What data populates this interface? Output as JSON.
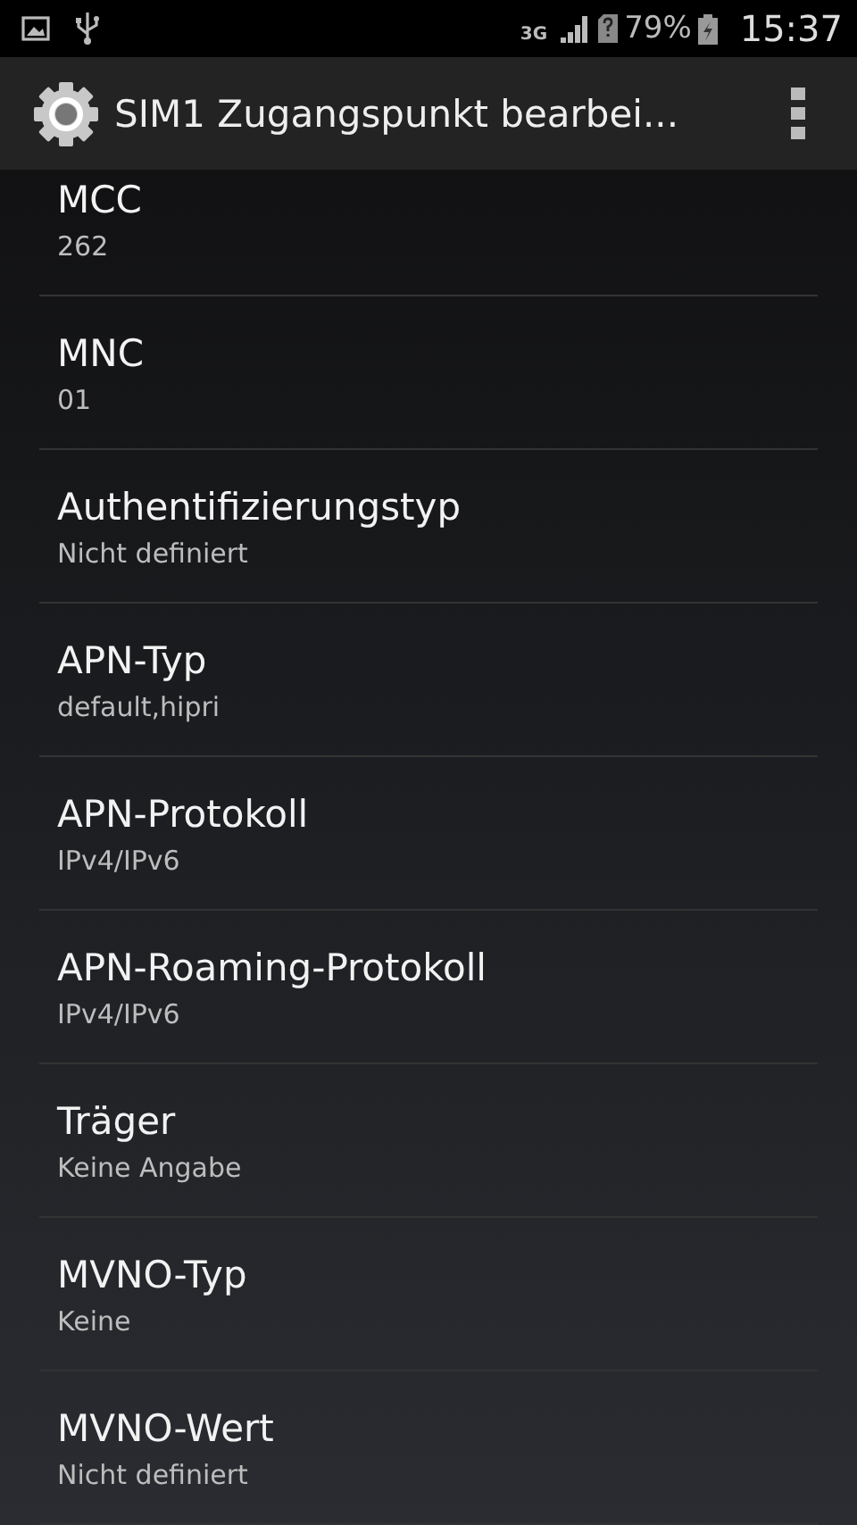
{
  "status_bar": {
    "network": "3G",
    "battery": "79%",
    "time": "15:37"
  },
  "action_bar": {
    "title": "SIM1 Zugangspunkt bearbei..."
  },
  "settings": [
    {
      "title": "MCC",
      "value": "262"
    },
    {
      "title": "MNC",
      "value": "01"
    },
    {
      "title": "Authentifizierungstyp",
      "value": "Nicht definiert"
    },
    {
      "title": "APN-Typ",
      "value": "default,hipri"
    },
    {
      "title": "APN-Protokoll",
      "value": "IPv4/IPv6"
    },
    {
      "title": "APN-Roaming-Protokoll",
      "value": "IPv4/IPv6"
    },
    {
      "title": "Träger",
      "value": "Keine Angabe"
    },
    {
      "title": "MVNO-Typ",
      "value": "Keine"
    },
    {
      "title": "MVNO-Wert",
      "value": "Nicht definiert"
    }
  ]
}
